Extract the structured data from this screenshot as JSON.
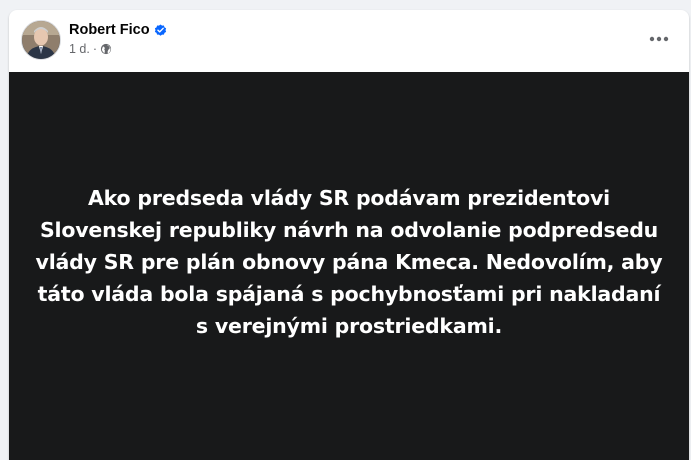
{
  "post": {
    "author": "Robert Fico",
    "time": "1 d.",
    "separator": "·",
    "privacy_icon": "globe-icon",
    "verified_icon": "verified-badge-icon",
    "more_icon": "more-options-icon",
    "text": "Ako predseda vlády SR podávam prezidentovi Slovenskej republiky návrh na odvolanie podpredsedu vlády SR pre plán obnovy pána Kmeca. Nedovolím, aby táto vláda bola spájaná s pochybnosťami pri nakladaní s verejnými prostriedkami."
  },
  "colors": {
    "verified": "#0866ff",
    "media_background": "#18191a",
    "meta_text": "#65676b"
  }
}
